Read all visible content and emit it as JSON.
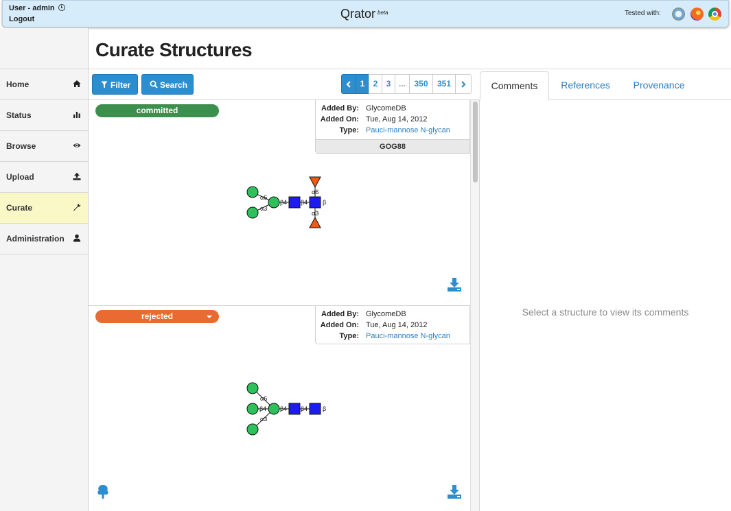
{
  "topbar": {
    "user_label": "User - admin",
    "logout_label": "Logout",
    "app_title": "Qrator",
    "app_badge": "beta",
    "tested_label": "Tested with:",
    "browsers": [
      "safari-icon",
      "firefox-icon",
      "chrome-icon"
    ]
  },
  "sidebar": {
    "active": "Curate",
    "items": [
      {
        "label": "Home",
        "icon": "home-icon"
      },
      {
        "label": "Status",
        "icon": "bar-chart-icon"
      },
      {
        "label": "Browse",
        "icon": "eye-icon"
      },
      {
        "label": "Upload",
        "icon": "upload-icon"
      },
      {
        "label": "Curate",
        "icon": "wrench-icon"
      },
      {
        "label": "Administration",
        "icon": "user-icon"
      }
    ]
  },
  "page": {
    "title": "Curate Structures"
  },
  "toolbar": {
    "filter_label": "Filter",
    "search_label": "Search"
  },
  "pagination": {
    "pages": [
      "1",
      "2",
      "3",
      "...",
      "350",
      "351"
    ],
    "current": "1"
  },
  "structures": [
    {
      "status": "committed",
      "added_by_label": "Added By:",
      "added_by": "GlycomeDB",
      "added_on_label": "Added On:",
      "added_on": "Tue, Aug 14, 2012",
      "type_label": "Type:",
      "type": "Pauci-mannose N-glycan",
      "id": "GOG88",
      "linkages": [
        "α6",
        "α3",
        "β4",
        "β4",
        "α6",
        "α3",
        "β"
      ]
    },
    {
      "status": "rejected",
      "added_by_label": "Added By:",
      "added_by": "GlycomeDB",
      "added_on_label": "Added On:",
      "added_on": "Tue, Aug 14, 2012",
      "type_label": "Type:",
      "type": "Pauci-mannose N-glycan",
      "linkages": [
        "α6",
        "β4",
        "α3",
        "β4",
        "β4",
        "β"
      ]
    }
  ],
  "right_panel": {
    "tabs": [
      "Comments",
      "References",
      "Provenance"
    ],
    "active_tab": "Comments",
    "empty_message": "Select a structure to view its comments"
  },
  "colors": {
    "accent": "#2d8ecf",
    "committed": "#3c8f4d",
    "rejected": "#ea6a33",
    "mannose": "#2ec05a",
    "glcnac": "#1c1cf0",
    "fucose": "#f05a14",
    "curate_highlight": "#fbf8c8"
  }
}
